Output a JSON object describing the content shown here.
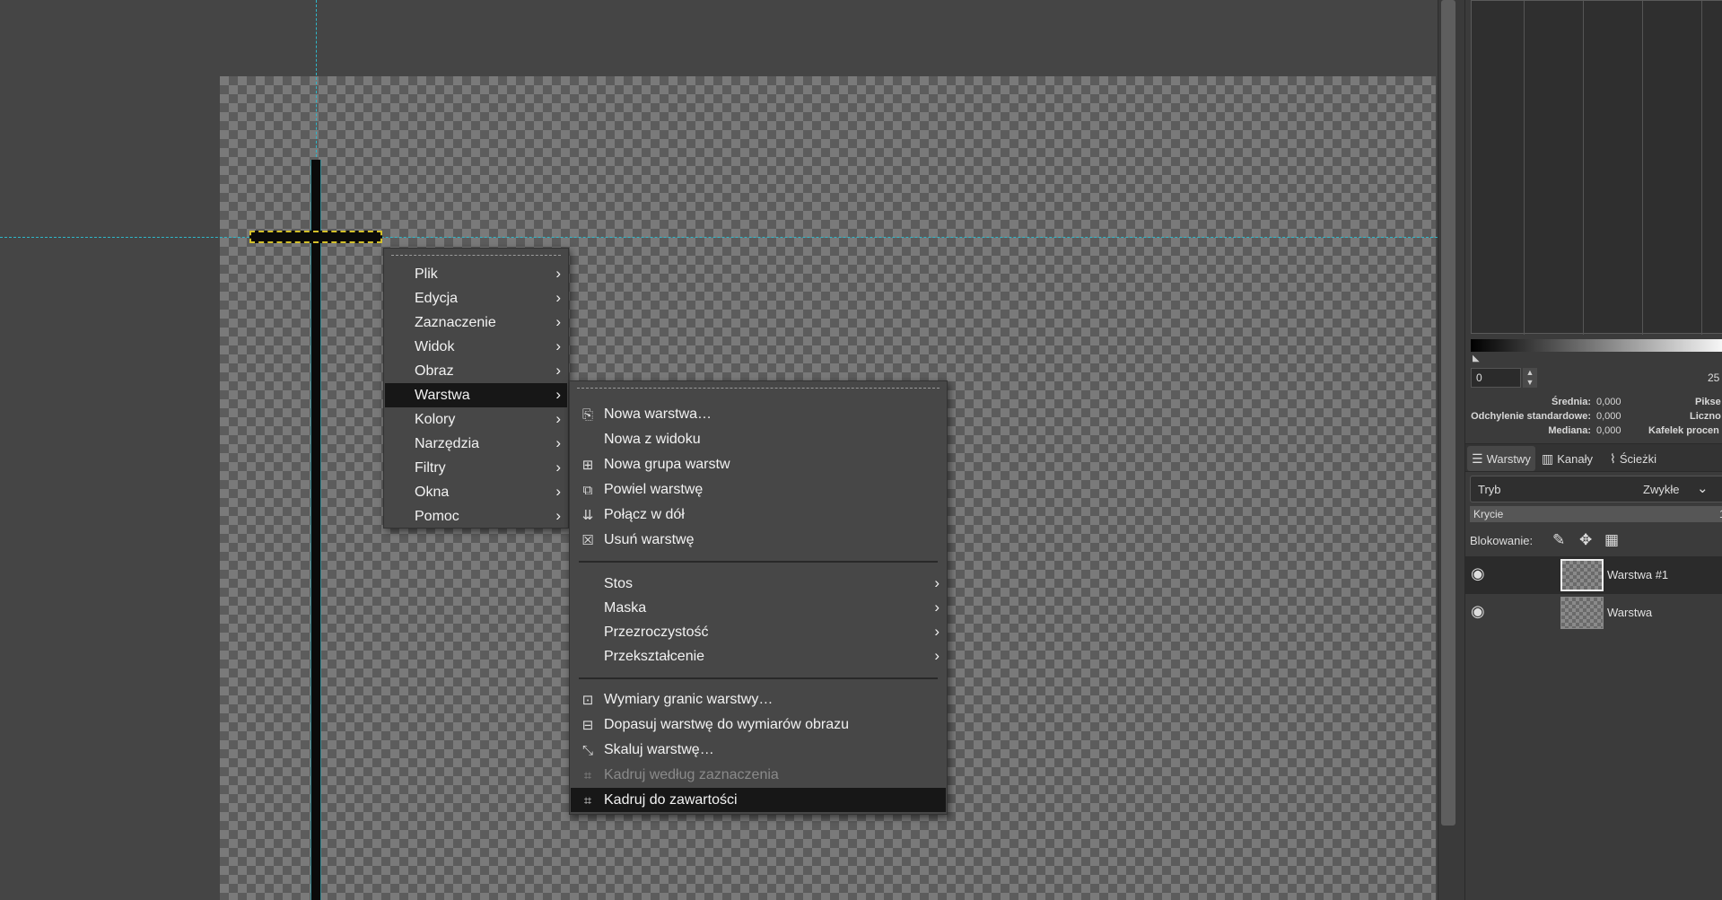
{
  "main_menu": {
    "items": [
      {
        "label": "Plik"
      },
      {
        "label": "Edycja"
      },
      {
        "label": "Zaznaczenie"
      },
      {
        "label": "Widok"
      },
      {
        "label": "Obraz"
      },
      {
        "label": "Warstwa",
        "highlighted": true
      },
      {
        "label": "Kolory"
      },
      {
        "label": "Narzędzia"
      },
      {
        "label": "Filtry"
      },
      {
        "label": "Okna"
      },
      {
        "label": "Pomoc"
      }
    ]
  },
  "layer_submenu": {
    "items": [
      {
        "label": "Nowa warstwa…",
        "icon": "new-layer-icon"
      },
      {
        "label": "Nowa z widoku"
      },
      {
        "label": "Nowa grupa warstw",
        "icon": "new-layer-group-icon"
      },
      {
        "label": "Powiel warstwę",
        "icon": "duplicate-layer-icon"
      },
      {
        "label": "Połącz w dół",
        "icon": "merge-down-icon"
      },
      {
        "label": "Usuń warstwę",
        "icon": "delete-layer-icon"
      },
      {
        "label": "Stos",
        "submenu": true
      },
      {
        "label": "Maska",
        "submenu": true
      },
      {
        "label": "Przezroczystość",
        "submenu": true
      },
      {
        "label": "Przekształcenie",
        "submenu": true
      },
      {
        "label": "Wymiary granic warstwy…",
        "icon": "layer-boundary-size-icon"
      },
      {
        "label": "Dopasuj warstwę do wymiarów obrazu",
        "icon": "layer-to-image-size-icon"
      },
      {
        "label": "Skaluj warstwę…",
        "icon": "scale-layer-icon"
      },
      {
        "label": "Kadruj według zaznaczenia",
        "icon": "crop-to-selection-icon",
        "disabled": true
      },
      {
        "label": "Kadruj do zawartości",
        "icon": "crop-to-content-icon",
        "highlighted": true
      }
    ]
  },
  "histogram": {
    "range_min": "0",
    "range_max": "25",
    "stats": {
      "mean_label": "Średnia:",
      "mean_value": "0,000",
      "stddev_label": "Odchylenie standardowe:",
      "stddev_value": "0,000",
      "median_label": "Mediana:",
      "median_value": "0,000",
      "pixels_label": "Pikse",
      "count_label": "Liczno",
      "percentile_label": "Kafelek procen"
    }
  },
  "dock_tabs": [
    {
      "label": "Warstwy",
      "icon": "layers-icon",
      "active": true
    },
    {
      "label": "Kanały",
      "icon": "channels-icon"
    },
    {
      "label": "Ścieżki",
      "icon": "paths-icon"
    }
  ],
  "layers_panel": {
    "mode_label": "Tryb",
    "mode_value": "Zwykłe",
    "opacity_label": "Krycie",
    "opacity_value": "1",
    "lock_label": "Blokowanie:",
    "layers": [
      {
        "name": "Warstwa #1",
        "visible": true,
        "active": true
      },
      {
        "name": "Warstwa",
        "visible": true,
        "active": false
      }
    ]
  },
  "colors": {
    "guide": "#2fb7c9",
    "menu_bg": "#474747",
    "menu_highlight": "#171717"
  }
}
